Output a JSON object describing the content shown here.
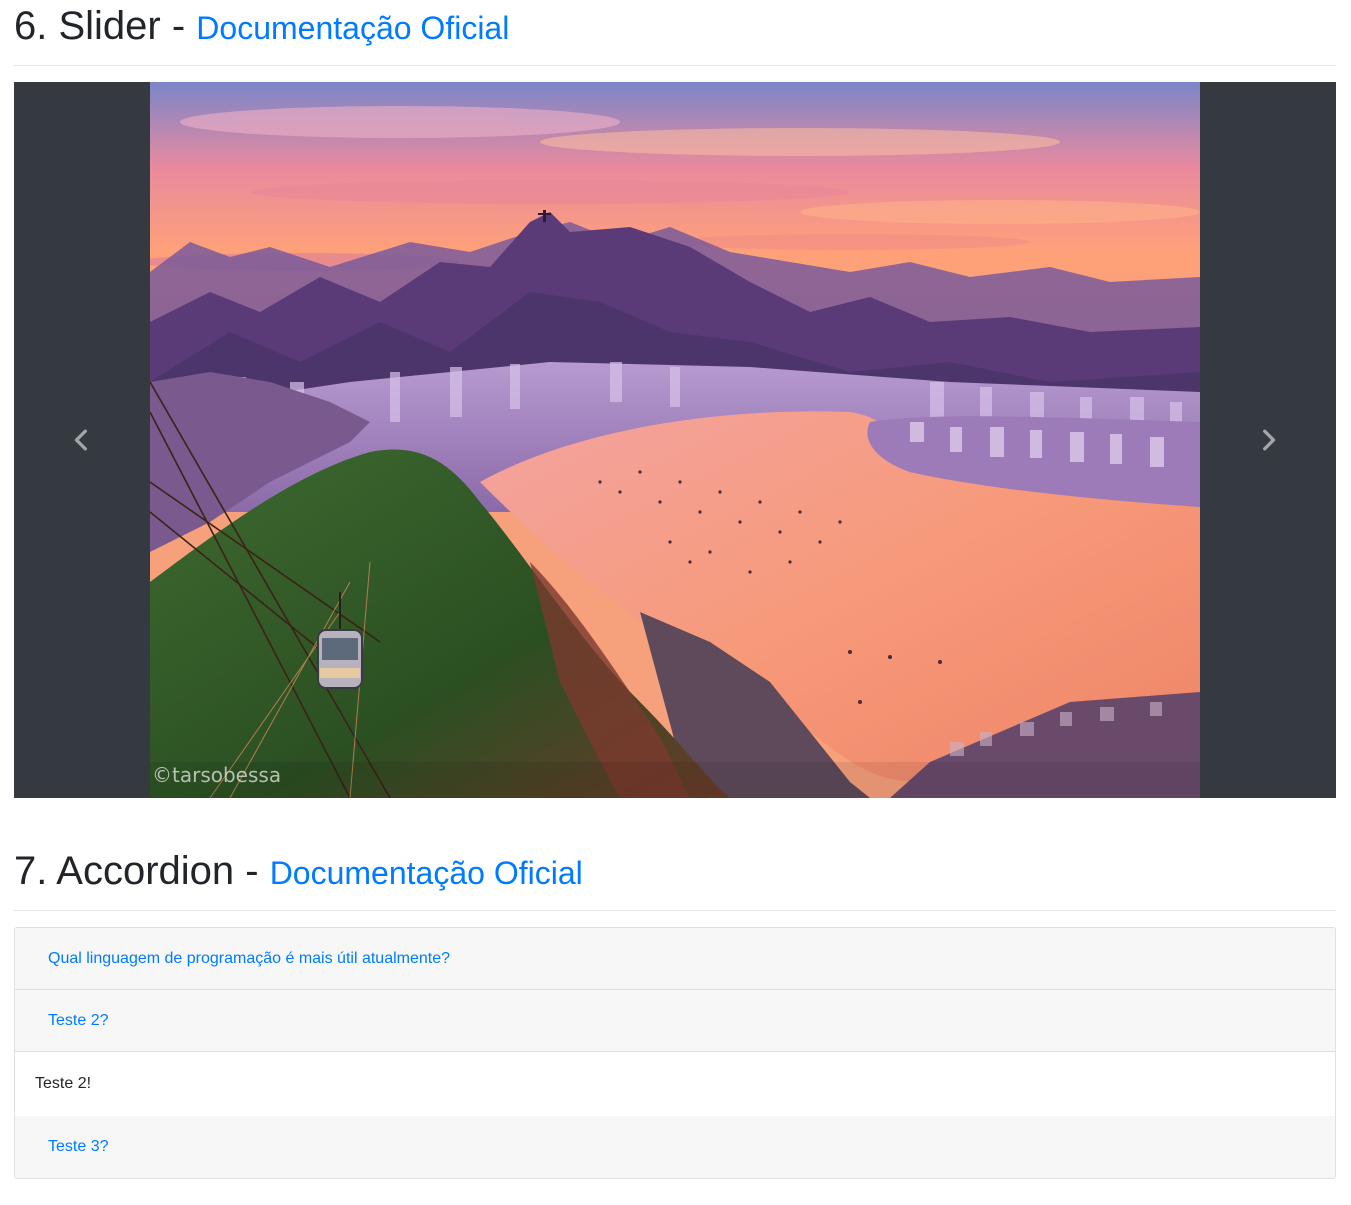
{
  "slider_section": {
    "title": "6. Slider - ",
    "doc_link": "Documentação Oficial"
  },
  "carousel": {
    "watermark": "©tarsobessa",
    "prev_icon": "chevron-left-icon",
    "next_icon": "chevron-right-icon",
    "colors": {
      "background": "#343a40",
      "sky_top": "#6f7fc8",
      "sunset": "#ff8c5a",
      "water": "#f49a7c",
      "mountains": "#5a3a7a",
      "forest": "#2f5a2a"
    }
  },
  "accordion_section": {
    "title": "7. Accordion - ",
    "doc_link": "Documentação Oficial"
  },
  "accordion": {
    "items": [
      {
        "question": "Qual linguagem de programação é mais útil atualmente?"
      },
      {
        "question": "Teste 2?",
        "answer": "Teste 2!"
      },
      {
        "question": "Teste 3?"
      }
    ]
  },
  "colors": {
    "link": "#007bff",
    "header_bg": "#f7f7f7",
    "border": "#dee2e6"
  }
}
